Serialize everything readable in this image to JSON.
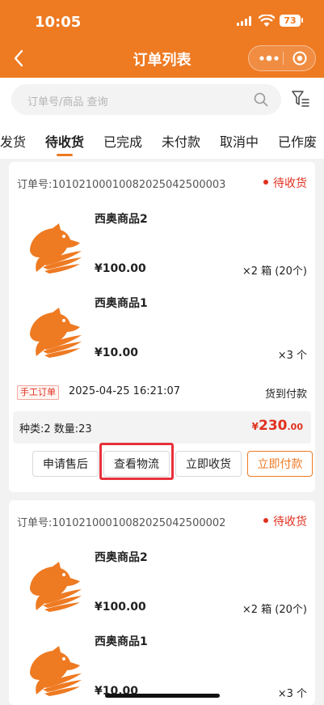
{
  "status_bar": {
    "time": "10:05",
    "battery": "73"
  },
  "header": {
    "title": "订单列表"
  },
  "search": {
    "placeholder": "订单号/商品 查询"
  },
  "tabs": [
    {
      "label": "发货"
    },
    {
      "label": "待收货",
      "active": true
    },
    {
      "label": "已完成"
    },
    {
      "label": "未付款"
    },
    {
      "label": "取消中"
    },
    {
      "label": "已作废"
    }
  ],
  "orders": [
    {
      "order_no": "订单号:10102100010082025042500003",
      "status": "待收货",
      "items": [
        {
          "name": "西奥商品2",
          "price": "¥100.00",
          "qty": "×2 箱 (20个)"
        },
        {
          "name": "西奥商品1",
          "price": "¥10.00",
          "qty": "×3 个"
        }
      ],
      "tag": "手工订单",
      "time": "2025-04-25 16:21:07",
      "pay_method": "货到付款",
      "summary": "种类:2 数量:23",
      "amount": {
        "symbol": "¥",
        "integer": "230",
        "decimal": ".00"
      },
      "buttons": [
        "申请售后",
        "查看物流",
        "立即收货",
        "立即付款"
      ]
    },
    {
      "order_no": "订单号:10102100010082025042500002",
      "status": "待收货",
      "items": [
        {
          "name": "西奥商品2",
          "price": "¥100.00",
          "qty": "×2 箱 (20个)"
        },
        {
          "name": "西奥商品1",
          "price": "¥10.00",
          "qty": "×3 个"
        }
      ]
    }
  ],
  "colors": {
    "brand": "#ee7a22",
    "status_red": "#e0311f",
    "highlight": "#e8323b"
  },
  "icons": [
    "back-arrow-icon",
    "more-dots-icon",
    "target-circle-icon",
    "search-icon",
    "filter-icon",
    "horse-logo-icon"
  ]
}
